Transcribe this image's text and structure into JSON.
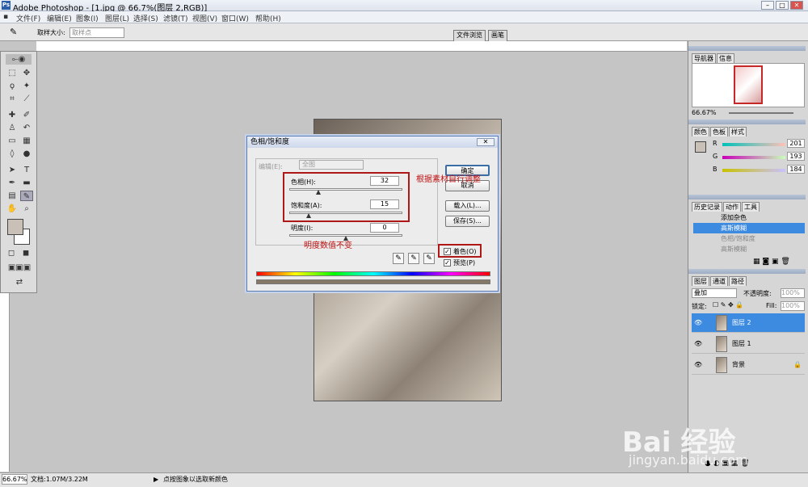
{
  "window": {
    "title": "Adobe Photoshop - [1.jpg @ 66.7%(图层 2,RGB)]"
  },
  "menu": [
    "文件(F)",
    "编辑(E)",
    "图象(I)",
    "图层(L)",
    "选择(S)",
    "滤镜(T)",
    "视图(V)",
    "窗口(W)",
    "帮助(H)"
  ],
  "options": {
    "sample_label": "取样大小:",
    "sample_value": "取样点"
  },
  "tabs": {
    "file_browser": "文件浏览",
    "brushes": "画笔"
  },
  "navigator": {
    "tabs": [
      "导航器",
      "信息"
    ],
    "zoom": "66.67%"
  },
  "color_panel": {
    "tabs": [
      "颜色",
      "色板",
      "样式"
    ],
    "r_label": "R",
    "g_label": "G",
    "b_label": "B",
    "r": "201",
    "g": "193",
    "b": "184",
    "colors": {
      "fg": "#c9c1b8"
    }
  },
  "history": {
    "tabs": [
      "历史记录",
      "动作",
      "工具"
    ],
    "items": [
      "添加杂色",
      "高斯模糊",
      "色相/饱和度",
      "高斯模糊"
    ]
  },
  "layers": {
    "tabs": [
      "图层",
      "通道",
      "路径"
    ],
    "blend_mode": "叠加",
    "opacity_label": "不透明度:",
    "opacity": "100%",
    "lock_label": "锁定:",
    "fill_label": "Fill:",
    "fill": "100%",
    "items": [
      "图层 2",
      "图层 1",
      "背景"
    ]
  },
  "dialog": {
    "title": "色相/饱和度",
    "edit_label": "编辑(E):",
    "edit_value": "全图",
    "hue_label": "色相(H):",
    "hue": "32",
    "sat_label": "饱和度(A):",
    "sat": "15",
    "light_label": "明度(I):",
    "light": "0",
    "ok": "确定",
    "cancel": "取消",
    "load": "载入(L)...",
    "save": "保存(S)...",
    "colorize": "着色(O)",
    "preview": "预览(P)",
    "hue_frac": 0.26,
    "sat_frac": 0.17,
    "light_frac": 0.5
  },
  "annotations": {
    "adjust": "根据素材自行调整",
    "lightness_note": "明度数值不变"
  },
  "status": {
    "zoom": "66.67%",
    "doc": "文档:1.07M/3.22M",
    "hint": "点按图象以选取新颜色"
  },
  "watermark": {
    "logo": "Bai 经验",
    "url": "jingyan.baidu.com"
  }
}
